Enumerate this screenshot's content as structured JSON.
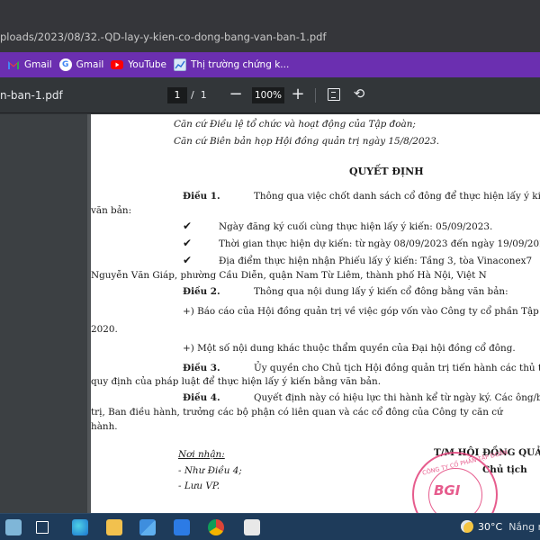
{
  "browser": {
    "url": "ploads/2023/08/32.-QD-lay-y-kien-co-dong-bang-van-ban-1.pdf",
    "bookmarks": [
      {
        "label": "Gmail",
        "icon": "gmail-icon"
      },
      {
        "label": "Gmail",
        "icon": "google-icon"
      },
      {
        "label": "YouTube",
        "icon": "youtube-icon"
      },
      {
        "label": "Thị trường chứng k...",
        "icon": "stock-chart-icon"
      }
    ],
    "bookmark_bar_color": "#6b2fb0"
  },
  "pdf_toolbar": {
    "file_title": "n-ban-1.pdf",
    "current_page": "1",
    "page_separator": "/",
    "total_pages": "1",
    "zoom_minus": "−",
    "zoom": "100%",
    "zoom_plus": "+",
    "rotate_glyph": "⟲"
  },
  "document": {
    "preamble_1": "Căn cứ Điều lệ tổ chức và hoạt động của Tập đoàn;",
    "preamble_2": "Căn cứ Biên bản họp Hội đồng quản trị ngày 15/8/2023.",
    "heading": "QUYẾT ĐỊNH",
    "dieu1_label": "Điều 1.",
    "dieu1_text": "Thông qua việc chốt danh sách cổ đông để thực hiện lấy ý kiến",
    "dieu1_cont": "văn bản:",
    "check_glyph": "✔",
    "bullet1": "Ngày đăng ký cuối cùng thực hiện lấy ý kiến: 05/09/2023.",
    "bullet2": "Thời gian thực hiện dự kiến: từ ngày 08/09/2023 đến ngày 19/09/2023.",
    "bullet3": "Địa điểm thực hiện nhận Phiếu lấy ý kiến: Tầng 3, tòa Vinaconex7",
    "bullet3_cont": "Nguyễn Văn Giáp, phường Cầu Diễn, quận Nam Từ Liêm, thành phố Hà Nội, Việt N",
    "dieu2_label": "Điều 2.",
    "dieu2_text": "Thông qua nội dung lấy ý kiến cổ đông bằng văn bản:",
    "dieu2_item1": "+) Báo cáo của Hội đồng quản trị về việc góp vốn vào Công ty cổ phần Tập",
    "dieu2_item1_cont": "2020.",
    "dieu2_item2": "+) Một số nội dung khác thuộc thẩm quyền của Đại hội đồng cổ đông.",
    "dieu3_label": "Điều 3.",
    "dieu3_text": "Ủy quyền cho Chủ tịch Hội đồng quản trị tiến hành các thủ tụ",
    "dieu3_cont": "quy định của pháp luật để thực hiện lấy ý kiến bằng văn bản.",
    "dieu4_label": "Điều 4.",
    "dieu4_text": "Quyết định này có hiệu lực thi hành kể từ ngày ký. Các ông/bà:",
    "dieu4_cont1": "trị, Ban điều hành, trưởng các bộ phận có liên quan và các cổ đông của Công ty căn cứ",
    "dieu4_cont2": "hành.",
    "recipients_title": "Nơi nhận:",
    "recipient1": "- Như Điều 4;",
    "recipient2": "- Lưu VP.",
    "signer_org": "T/M HỘI ĐỒNG QUẢ",
    "signer_title": "Chủ tịch",
    "stamp_logo": "BGI",
    "stamp_text": "CÔNG TY CỔ PHẦN TẬP ĐOÀN"
  },
  "taskbar": {
    "temperature": "30°C",
    "weather_text": "Nắng n"
  }
}
